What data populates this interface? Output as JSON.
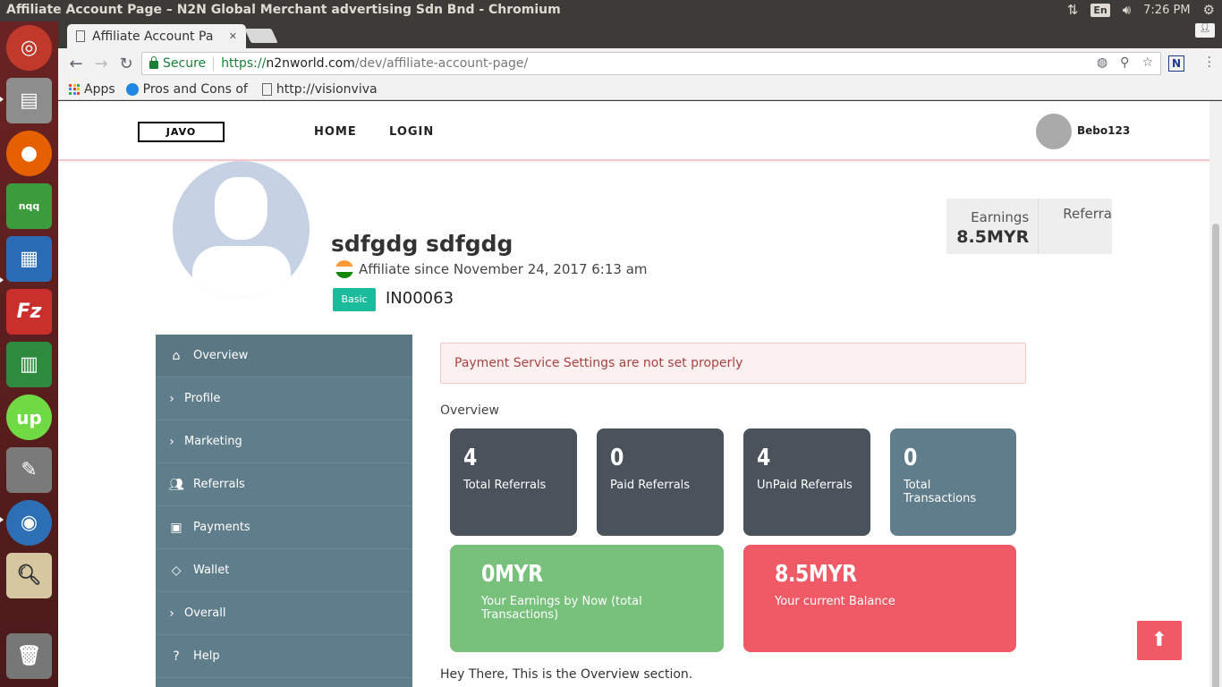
{
  "os": {
    "window_title": "Affiliate Account Page – N2N Global Merchant advertising Sdn Bnd - Chromium",
    "lang": "En",
    "time": "7:26 PM"
  },
  "browser": {
    "tab_title": "Affiliate Account Pa",
    "tab_close": "✕",
    "secure_label": "Secure",
    "url_scheme": "https://",
    "url_host": "n2nworld.com",
    "url_path": "/dev/affiliate-account-page/",
    "bookmarks": {
      "apps": "Apps",
      "pros": "Pros and Cons of",
      "vision": "http://visionviva"
    },
    "extension_label": "N"
  },
  "site": {
    "logo": "JAVO",
    "nav": {
      "home": "HOME",
      "login": "LOGIN"
    },
    "username": "Bebo123"
  },
  "profile": {
    "name": "sdfgdg sdfgdg",
    "since": "Affiliate since November 24, 2017 6:13 am",
    "badge": "Basic",
    "code": "IN00063",
    "earnings_label": "Earnings",
    "earnings_value": "8.5MYR",
    "referrals_label": "Referra"
  },
  "sidebar": {
    "items": [
      {
        "label": "Overview",
        "icon": "home-icon"
      },
      {
        "label": "Profile",
        "icon": "chevron-right-icon"
      },
      {
        "label": "Marketing",
        "icon": "chevron-right-icon"
      },
      {
        "label": "Referrals",
        "icon": "users-icon"
      },
      {
        "label": "Payments",
        "icon": "money-icon"
      },
      {
        "label": "Wallet",
        "icon": "diamond-icon"
      },
      {
        "label": "Overall",
        "icon": "chevron-right-icon"
      },
      {
        "label": "Help",
        "icon": "question-icon"
      }
    ]
  },
  "main": {
    "alert": "Payment Service Settings are not set properly",
    "section_label": "Overview",
    "cards": {
      "total_referrals": {
        "value": "4",
        "label": "Total Referrals"
      },
      "paid_referrals": {
        "value": "0",
        "label": "Paid Referrals"
      },
      "unpaid_referrals": {
        "value": "4",
        "label": "UnPaid Referrals"
      },
      "total_transactions": {
        "value": "0",
        "label": "Total Transactions"
      },
      "earnings": {
        "value": "0MYR",
        "label": "Your Earnings by Now (total Transactions)"
      },
      "balance": {
        "value": "8.5MYR",
        "label": "Your current Balance"
      }
    },
    "overview_text": "Hey There, This is the Overview section."
  },
  "colors": {
    "accent_red": "#f05a66",
    "green": "#78c17c",
    "sidebar": "#607d8b",
    "badge": "#1bbc9b"
  }
}
